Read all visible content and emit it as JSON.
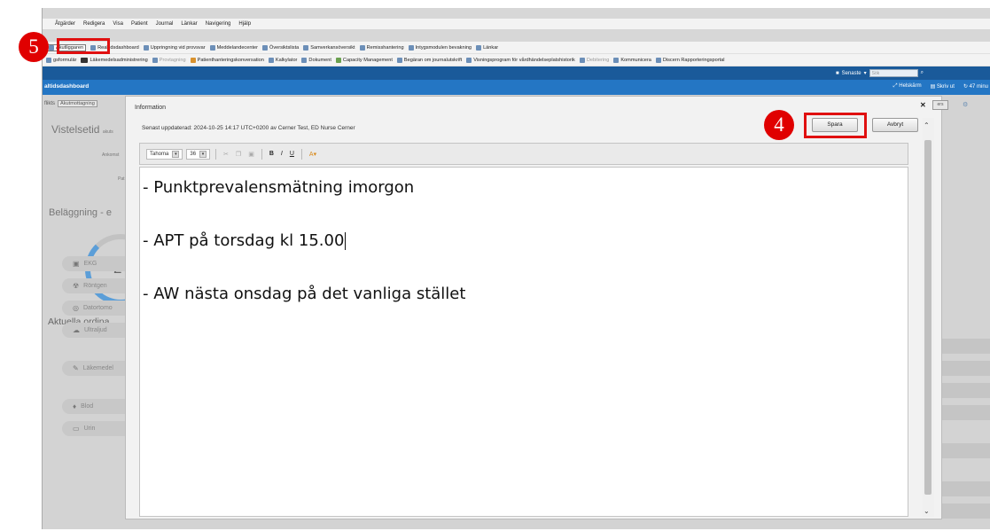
{
  "menu": [
    "Åtgärder",
    "Redigera",
    "Visa",
    "Patient",
    "Journal",
    "Länkar",
    "Navigering",
    "Hjälp"
  ],
  "toolbar1": [
    {
      "label": "Akutliggaren",
      "icon": "document-icon"
    },
    {
      "label": "Realtidsdashboard",
      "icon": "grid-icon"
    },
    {
      "label": "Uppringning vid provsvar",
      "icon": "grid-icon"
    },
    {
      "label": "Meddelandecenter",
      "icon": "document-icon"
    },
    {
      "label": "Översiktslista",
      "icon": "grid-icon"
    },
    {
      "label": "Samverkansöversikt",
      "icon": "grid-icon"
    },
    {
      "label": "Remisshantering",
      "icon": "grid-icon"
    },
    {
      "label": "Intygsmodulen bevakning",
      "icon": "grid-icon"
    },
    {
      "label": "Länkar",
      "icon": "document-icon"
    }
  ],
  "toolbar2": [
    {
      "label": "gsformulär",
      "icon": "document-icon",
      "dim": false
    },
    {
      "label": "Läkemedelsadministrering",
      "icon": "pill-icon",
      "dim": false
    },
    {
      "label": "Provtagning",
      "icon": "flask-icon",
      "dim": true
    },
    {
      "label": "Patienthanteringskonversation",
      "icon": "person-icon",
      "dim": false
    },
    {
      "label": "Kalkylator",
      "icon": "calculator-icon",
      "dim": false
    },
    {
      "label": "Dokument",
      "icon": "document-icon",
      "dim": false
    },
    {
      "label": "Capacity Management",
      "icon": "chart-icon",
      "dim": false
    },
    {
      "label": "Begäran om journalutskrift",
      "icon": "document-icon",
      "dim": false
    },
    {
      "label": "Visningsprogram för vårdhändelseplatshistorik",
      "icon": "grid-icon",
      "dim": false
    },
    {
      "label": "Debitering",
      "icon": "money-icon",
      "dim": true
    },
    {
      "label": "Kommunicera",
      "icon": "mail-icon",
      "dim": false
    },
    {
      "label": "Discern Rapporteringsportal",
      "icon": "globe-icon",
      "dim": false
    }
  ],
  "header": {
    "senaste": "Senaste",
    "search_placeholder": "Sök",
    "dashboard_title": "altidsdashboard",
    "helskarm": "Helskärm",
    "skriv_ut": "Skriv ut",
    "timer": "47 minu"
  },
  "background": {
    "flik_label": "flikts",
    "flik_value": "Akutmottagning",
    "vistelsetid": "Vistelsetid",
    "vistelsetid_suffix": "akuts",
    "ankomst": "Ankomst",
    "pat": "Pat",
    "belaggning": "Beläggning - e",
    "donut_value": "2",
    "aktuella": "Aktuella ordina",
    "orders": [
      "EKG",
      "Röntgen",
      "Datortomo",
      "Ultraljud",
      "Läkemedel",
      "Blod",
      "Urin"
    ]
  },
  "modal": {
    "title": "Information",
    "last_updated": "Senast uppdaterad: 2024-10-25 14:17 UTC+0200 av Cerner Test, ED Nurse Cerner",
    "save_label": "Spara",
    "cancel_label": "Avbryt",
    "font_family": "Tahoma",
    "font_size": "36",
    "content": [
      "- Punktprevalensmätning imorgon",
      "- APT på torsdag kl 15.00",
      "- AW nästa onsdag på det vanliga stället"
    ]
  },
  "badges": {
    "step4": "4",
    "step5": "5"
  },
  "colors": {
    "highlight": "#e01010",
    "badge": "#e00000",
    "header_blue": "#1a5a9a"
  }
}
